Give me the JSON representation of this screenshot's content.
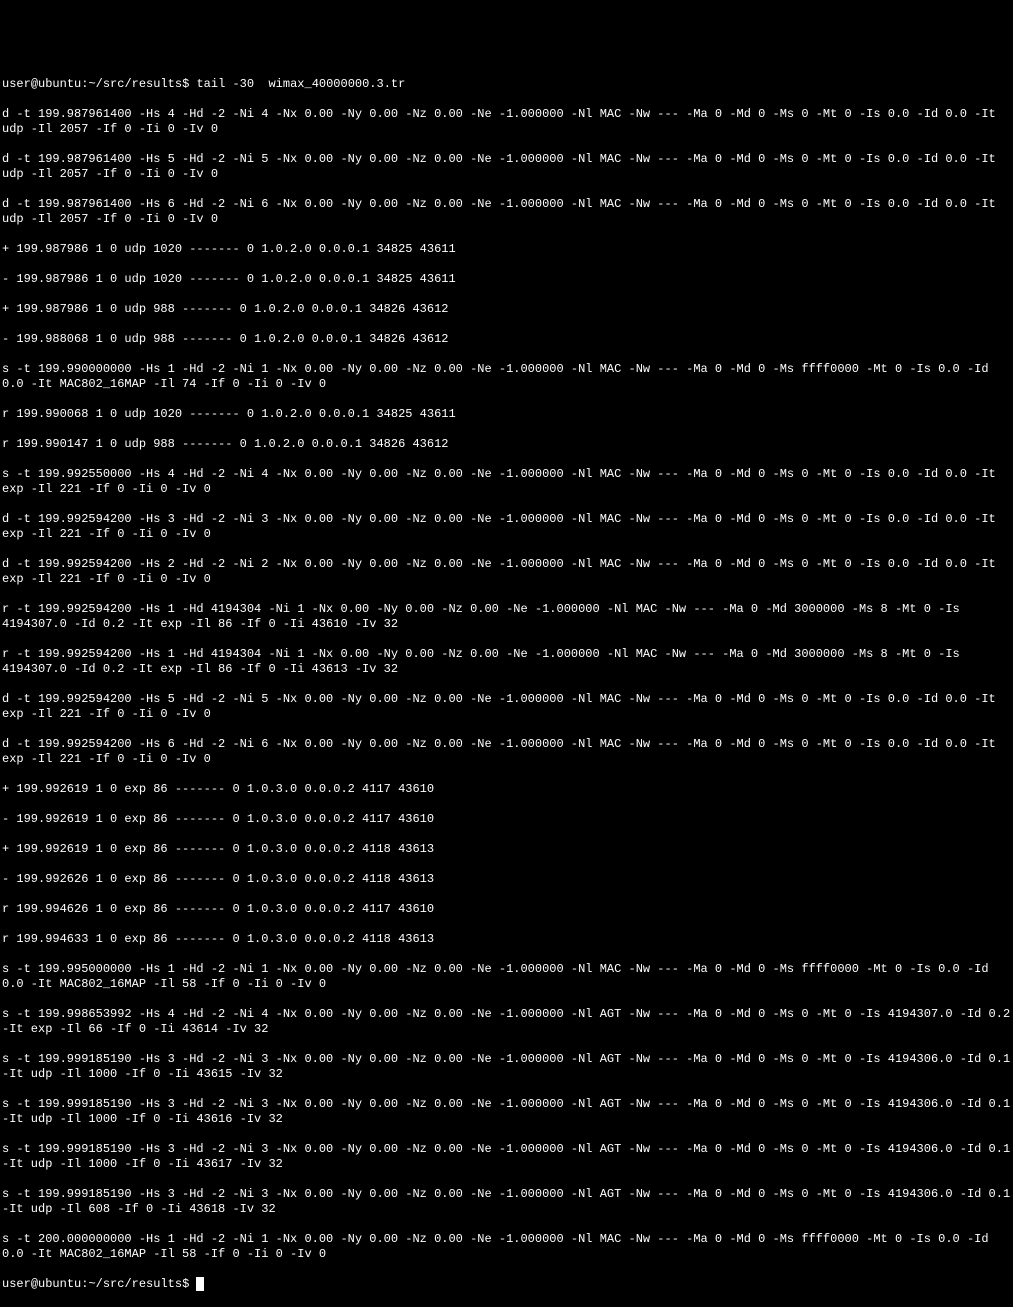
{
  "prompt": {
    "user": "user",
    "host": "ubuntu",
    "path": "~/src/results",
    "command": "tail -30  wimax_40000000.3.tr"
  },
  "lines": [
    "d -t 199.987961400 -Hs 4 -Hd -2 -Ni 4 -Nx 0.00 -Ny 0.00 -Nz 0.00 -Ne -1.000000 -Nl MAC -Nw --- -Ma 0 -Md 0 -Ms 0 -Mt 0 -Is 0.0 -Id 0.0 -It udp -Il 2057 -If 0 -Ii 0 -Iv 0",
    "d -t 199.987961400 -Hs 5 -Hd -2 -Ni 5 -Nx 0.00 -Ny 0.00 -Nz 0.00 -Ne -1.000000 -Nl MAC -Nw --- -Ma 0 -Md 0 -Ms 0 -Mt 0 -Is 0.0 -Id 0.0 -It udp -Il 2057 -If 0 -Ii 0 -Iv 0",
    "d -t 199.987961400 -Hs 6 -Hd -2 -Ni 6 -Nx 0.00 -Ny 0.00 -Nz 0.00 -Ne -1.000000 -Nl MAC -Nw --- -Ma 0 -Md 0 -Ms 0 -Mt 0 -Is 0.0 -Id 0.0 -It udp -Il 2057 -If 0 -Ii 0 -Iv 0",
    "+ 199.987986 1 0 udp 1020 ------- 0 1.0.2.0 0.0.0.1 34825 43611",
    "- 199.987986 1 0 udp 1020 ------- 0 1.0.2.0 0.0.0.1 34825 43611",
    "+ 199.987986 1 0 udp 988 ------- 0 1.0.2.0 0.0.0.1 34826 43612",
    "- 199.988068 1 0 udp 988 ------- 0 1.0.2.0 0.0.0.1 34826 43612",
    "s -t 199.990000000 -Hs 1 -Hd -2 -Ni 1 -Nx 0.00 -Ny 0.00 -Nz 0.00 -Ne -1.000000 -Nl MAC -Nw --- -Ma 0 -Md 0 -Ms ffff0000 -Mt 0 -Is 0.0 -Id 0.0 -It MAC802_16MAP -Il 74 -If 0 -Ii 0 -Iv 0",
    "r 199.990068 1 0 udp 1020 ------- 0 1.0.2.0 0.0.0.1 34825 43611",
    "r 199.990147 1 0 udp 988 ------- 0 1.0.2.0 0.0.0.1 34826 43612",
    "s -t 199.992550000 -Hs 4 -Hd -2 -Ni 4 -Nx 0.00 -Ny 0.00 -Nz 0.00 -Ne -1.000000 -Nl MAC -Nw --- -Ma 0 -Md 0 -Ms 0 -Mt 0 -Is 0.0 -Id 0.0 -It exp -Il 221 -If 0 -Ii 0 -Iv 0",
    "d -t 199.992594200 -Hs 3 -Hd -2 -Ni 3 -Nx 0.00 -Ny 0.00 -Nz 0.00 -Ne -1.000000 -Nl MAC -Nw --- -Ma 0 -Md 0 -Ms 0 -Mt 0 -Is 0.0 -Id 0.0 -It exp -Il 221 -If 0 -Ii 0 -Iv 0",
    "d -t 199.992594200 -Hs 2 -Hd -2 -Ni 2 -Nx 0.00 -Ny 0.00 -Nz 0.00 -Ne -1.000000 -Nl MAC -Nw --- -Ma 0 -Md 0 -Ms 0 -Mt 0 -Is 0.0 -Id 0.0 -It exp -Il 221 -If 0 -Ii 0 -Iv 0",
    "r -t 199.992594200 -Hs 1 -Hd 4194304 -Ni 1 -Nx 0.00 -Ny 0.00 -Nz 0.00 -Ne -1.000000 -Nl MAC -Nw --- -Ma 0 -Md 3000000 -Ms 8 -Mt 0 -Is 4194307.0 -Id 0.2 -It exp -Il 86 -If 0 -Ii 43610 -Iv 32",
    "r -t 199.992594200 -Hs 1 -Hd 4194304 -Ni 1 -Nx 0.00 -Ny 0.00 -Nz 0.00 -Ne -1.000000 -Nl MAC -Nw --- -Ma 0 -Md 3000000 -Ms 8 -Mt 0 -Is 4194307.0 -Id 0.2 -It exp -Il 86 -If 0 -Ii 43613 -Iv 32",
    "d -t 199.992594200 -Hs 5 -Hd -2 -Ni 5 -Nx 0.00 -Ny 0.00 -Nz 0.00 -Ne -1.000000 -Nl MAC -Nw --- -Ma 0 -Md 0 -Ms 0 -Mt 0 -Is 0.0 -Id 0.0 -It exp -Il 221 -If 0 -Ii 0 -Iv 0",
    "d -t 199.992594200 -Hs 6 -Hd -2 -Ni 6 -Nx 0.00 -Ny 0.00 -Nz 0.00 -Ne -1.000000 -Nl MAC -Nw --- -Ma 0 -Md 0 -Ms 0 -Mt 0 -Is 0.0 -Id 0.0 -It exp -Il 221 -If 0 -Ii 0 -Iv 0",
    "+ 199.992619 1 0 exp 86 ------- 0 1.0.3.0 0.0.0.2 4117 43610",
    "- 199.992619 1 0 exp 86 ------- 0 1.0.3.0 0.0.0.2 4117 43610",
    "+ 199.992619 1 0 exp 86 ------- 0 1.0.3.0 0.0.0.2 4118 43613",
    "- 199.992626 1 0 exp 86 ------- 0 1.0.3.0 0.0.0.2 4118 43613",
    "r 199.994626 1 0 exp 86 ------- 0 1.0.3.0 0.0.0.2 4117 43610",
    "r 199.994633 1 0 exp 86 ------- 0 1.0.3.0 0.0.0.2 4118 43613",
    "s -t 199.995000000 -Hs 1 -Hd -2 -Ni 1 -Nx 0.00 -Ny 0.00 -Nz 0.00 -Ne -1.000000 -Nl MAC -Nw --- -Ma 0 -Md 0 -Ms ffff0000 -Mt 0 -Is 0.0 -Id 0.0 -It MAC802_16MAP -Il 58 -If 0 -Ii 0 -Iv 0",
    "s -t 199.998653992 -Hs 4 -Hd -2 -Ni 4 -Nx 0.00 -Ny 0.00 -Nz 0.00 -Ne -1.000000 -Nl AGT -Nw --- -Ma 0 -Md 0 -Ms 0 -Mt 0 -Is 4194307.0 -Id 0.2 -It exp -Il 66 -If 0 -Ii 43614 -Iv 32",
    "s -t 199.999185190 -Hs 3 -Hd -2 -Ni 3 -Nx 0.00 -Ny 0.00 -Nz 0.00 -Ne -1.000000 -Nl AGT -Nw --- -Ma 0 -Md 0 -Ms 0 -Mt 0 -Is 4194306.0 -Id 0.1 -It udp -Il 1000 -If 0 -Ii 43615 -Iv 32",
    "s -t 199.999185190 -Hs 3 -Hd -2 -Ni 3 -Nx 0.00 -Ny 0.00 -Nz 0.00 -Ne -1.000000 -Nl AGT -Nw --- -Ma 0 -Md 0 -Ms 0 -Mt 0 -Is 4194306.0 -Id 0.1 -It udp -Il 1000 -If 0 -Ii 43616 -Iv 32",
    "s -t 199.999185190 -Hs 3 -Hd -2 -Ni 3 -Nx 0.00 -Ny 0.00 -Nz 0.00 -Ne -1.000000 -Nl AGT -Nw --- -Ma 0 -Md 0 -Ms 0 -Mt 0 -Is 4194306.0 -Id 0.1 -It udp -Il 1000 -If 0 -Ii 43617 -Iv 32",
    "s -t 199.999185190 -Hs 3 -Hd -2 -Ni 3 -Nx 0.00 -Ny 0.00 -Nz 0.00 -Ne -1.000000 -Nl AGT -Nw --- -Ma 0 -Md 0 -Ms 0 -Mt 0 -Is 4194306.0 -Id 0.1 -It udp -Il 608 -If 0 -Ii 43618 -Iv 32",
    "s -t 200.000000000 -Hs 1 -Hd -2 -Ni 1 -Nx 0.00 -Ny 0.00 -Nz 0.00 -Ne -1.000000 -Nl MAC -Nw --- -Ma 0 -Md 0 -Ms ffff0000 -Mt 0 -Is 0.0 -Id 0.0 -It MAC802_16MAP -Il 58 -If 0 -Ii 0 -Iv 0"
  ],
  "prompt2": {
    "user": "user",
    "host": "ubuntu",
    "path": "~/src/results"
  }
}
